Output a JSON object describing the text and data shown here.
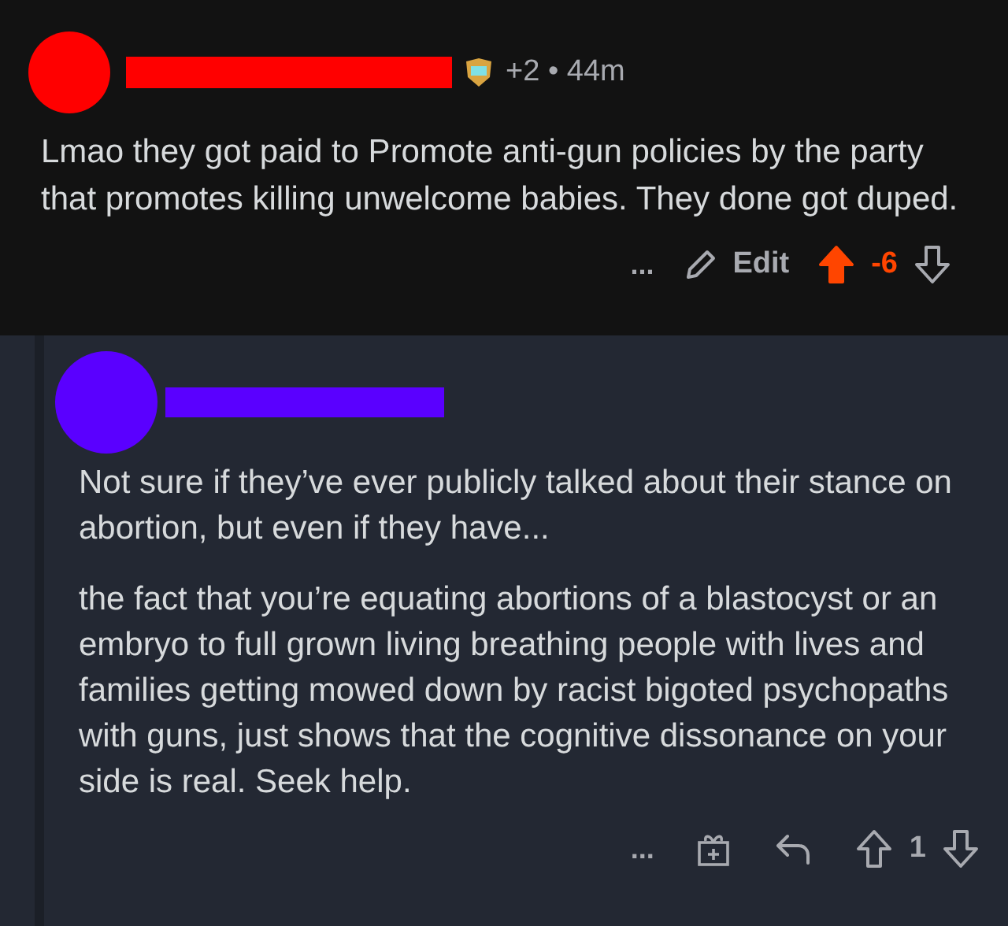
{
  "comment": {
    "meta": "+2 • 44m",
    "body": [
      "Lmao they got paid to Promote anti-gun policies by the party that promotes killing unwelcome babies. They done got duped."
    ],
    "actions": {
      "more": "...",
      "edit": "Edit",
      "score": "-6",
      "upvoted": true
    }
  },
  "reply": {
    "body": [
      "Not sure if they’ve ever publicly talked about their stance on abortion, but even if they have...",
      "the fact that you’re equating abortions of a blastocyst or an embryo to full grown living breathing people with lives and families getting mowed down by racist bigoted psychopaths with guns, just shows that the cognitive dissonance on your side is real. Seek help."
    ],
    "actions": {
      "more": "...",
      "score": "1",
      "upvoted": false
    }
  }
}
